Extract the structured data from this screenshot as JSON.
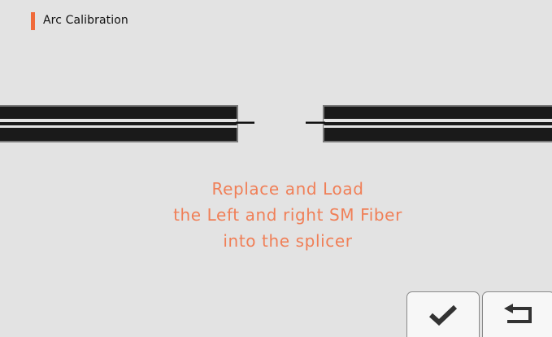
{
  "header": {
    "title": "Arc Calibration",
    "accent_color": "#f06a3a"
  },
  "message": {
    "lines": [
      "Replace and Load",
      "the Left and right SM Fiber",
      "into the splicer"
    ],
    "color": "#f07f57"
  },
  "buttons": {
    "confirm_icon": "checkmark-icon",
    "back_icon": "return-arrow-icon"
  }
}
